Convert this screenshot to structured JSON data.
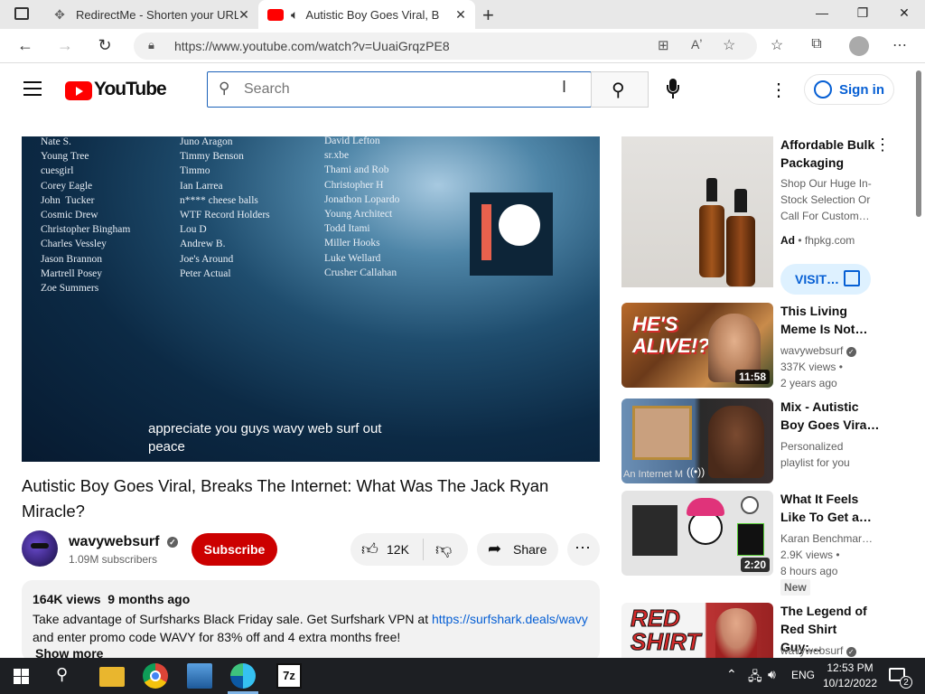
{
  "browser": {
    "tabs": [
      {
        "title": "RedirectMe - Shorten your URL f",
        "active": false
      },
      {
        "title": "Autistic Boy Goes Viral, Brea",
        "active": true
      }
    ],
    "url": "https://www.youtube.com/watch?v=UuaiGrqzPE8"
  },
  "youtube": {
    "logo_text": "YouTube",
    "search_placeholder": "Search",
    "sign_in_label": "Sign in"
  },
  "video": {
    "credits_col1": [
      "Nate S.",
      "Young Tree",
      "cuesgirl",
      "Corey Eagle",
      "John  Tucker",
      "Cosmic Drew",
      "Christopher Bingham",
      "Charles Vessley",
      "Jason Brannon",
      "Martrell Posey",
      "Zoe Summers"
    ],
    "credits_col2": [
      "Juno Aragon",
      "Timmy Benson",
      "Timmo",
      "Ian Larrea",
      "n**** cheese balls",
      "WTF Record Holders",
      "Lou D",
      "Andrew B.",
      "Joe's Around",
      "Peter Actual"
    ],
    "credits_col3": [
      "David Lefton",
      "sr.xbe",
      "Thami and Rob",
      "Christopher H",
      "Jonathon Lopardo",
      "Young Architect",
      "Todd Itami",
      "Miller Hooks",
      "Luke Wellard",
      "Crusher Callahan"
    ],
    "caption_line1": "appreciate you guys wavy web surf out",
    "caption_line2": "peace",
    "title": "Autistic Boy Goes Viral, Breaks The Internet: What Was The Jack Ryan Miracle?"
  },
  "channel": {
    "name": "wavywebsurf",
    "subscribers": "1.09M subscribers",
    "subscribe_label": "Subscribe"
  },
  "actions": {
    "likes": "12K",
    "share_label": "Share"
  },
  "description": {
    "views": "164K views",
    "age": "9 months ago",
    "text_before_link": "Take advantage of Surfsharks Black Friday sale. Get Surfshark VPN at ",
    "link": "https://surfshark.deals/wavy",
    "text_after_link": " and enter promo code WAVY for 83% off and 4 extra months free!",
    "show_more": "Show more"
  },
  "sidebar": {
    "ad": {
      "title": "Affordable Bulk Packaging",
      "body": "Shop Our Huge In-Stock Selection Or Call For Custom…",
      "badge": "Ad",
      "domain": "fhpkg.com",
      "cta": "VISIT…"
    },
    "items": [
      {
        "title": "This Living Meme Is Not…",
        "channel": "wavywebsurf",
        "views": "337K views •",
        "age": "2 years ago",
        "duration": "11:58",
        "thumb_text": "HE'S ALIVE!?"
      },
      {
        "title": "Mix - Autistic Boy Goes Vira…",
        "channel": "Personalized",
        "views": "playlist for you",
        "age": "",
        "duration": "",
        "thumb_text": "An Internet M"
      },
      {
        "title": "What It Feels Like To Get a…",
        "channel": "Karan Benchmar…",
        "views": "2.9K views •",
        "age": "8 hours ago",
        "duration": "2:20",
        "badge": "New"
      },
      {
        "title": "The Legend of Red Shirt Guy:…",
        "channel": "wavywebsurf",
        "views": "",
        "age": "",
        "duration": "",
        "thumb_text": "RED SHIRT"
      }
    ]
  },
  "taskbar": {
    "language": "ENG",
    "time": "12:53 PM",
    "date": "10/12/2022",
    "notifications": "2"
  },
  "colors": {
    "youtube_red": "#ff0000",
    "subscribe_red": "#cc0000",
    "link_blue": "#065fd4"
  }
}
